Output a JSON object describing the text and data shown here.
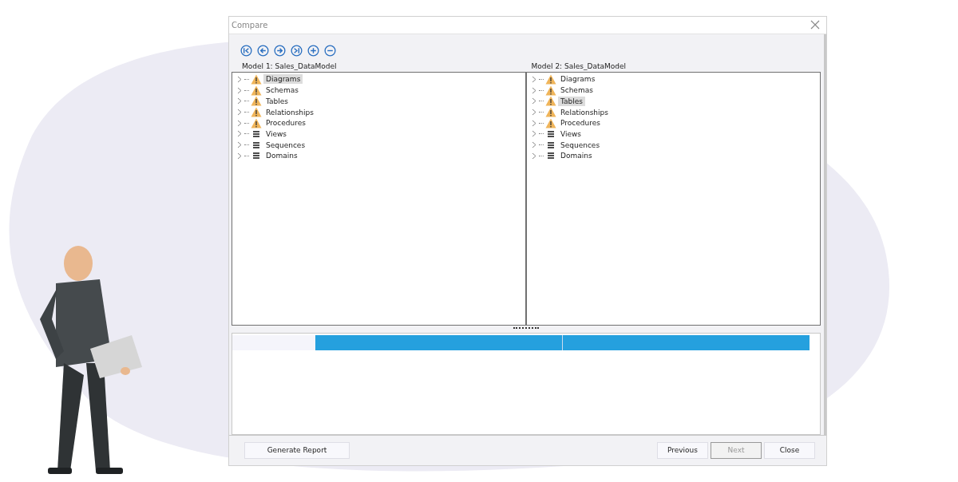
{
  "window": {
    "title": "Compare"
  },
  "toolbar": [
    {
      "kind": "first"
    },
    {
      "kind": "prev"
    },
    {
      "kind": "next"
    },
    {
      "kind": "last"
    },
    {
      "kind": "expand"
    },
    {
      "kind": "collapse"
    }
  ],
  "panes": [
    {
      "label": "Model 1: Sales_DataModel",
      "items": [
        {
          "label": "Diagrams",
          "kind": "warning",
          "selected": true
        },
        {
          "label": "Schemas",
          "kind": "warning",
          "selected": false
        },
        {
          "label": "Tables",
          "kind": "warning",
          "selected": false
        },
        {
          "label": "Relationships",
          "kind": "warning",
          "selected": false
        },
        {
          "label": "Procedures",
          "kind": "warning",
          "selected": false
        },
        {
          "label": "Views",
          "kind": "list",
          "selected": false
        },
        {
          "label": "Sequences",
          "kind": "list",
          "selected": false
        },
        {
          "label": "Domains",
          "kind": "list",
          "selected": false
        }
      ]
    },
    {
      "label": "Model 2: Sales_DataModel",
      "items": [
        {
          "label": "Diagrams",
          "kind": "warning",
          "selected": false
        },
        {
          "label": "Schemas",
          "kind": "warning",
          "selected": false
        },
        {
          "label": "Tables",
          "kind": "warning",
          "selected": true
        },
        {
          "label": "Relationships",
          "kind": "warning",
          "selected": false
        },
        {
          "label": "Procedures",
          "kind": "warning",
          "selected": false
        },
        {
          "label": "Views",
          "kind": "list",
          "selected": false
        },
        {
          "label": "Sequences",
          "kind": "list",
          "selected": false
        },
        {
          "label": "Domains",
          "kind": "list",
          "selected": false
        }
      ]
    }
  ],
  "footer": {
    "left": [
      {
        "label": "Generate Report",
        "disabled": false
      }
    ],
    "right": [
      {
        "label": "Previous",
        "disabled": false
      },
      {
        "label": "Next",
        "disabled": true
      },
      {
        "label": "Close",
        "disabled": false
      }
    ]
  }
}
